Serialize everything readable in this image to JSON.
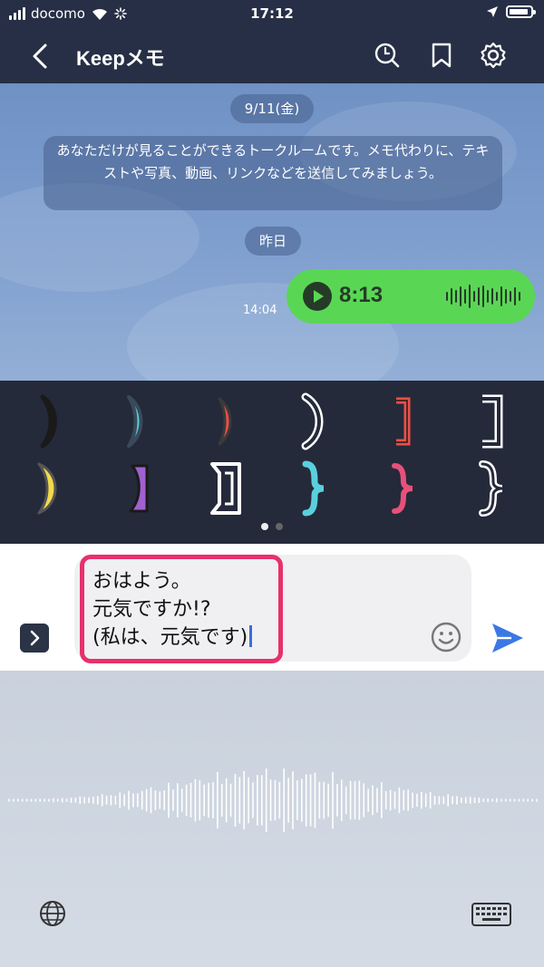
{
  "status_bar": {
    "carrier": "docomo",
    "time": "17:12"
  },
  "nav": {
    "title": "Keepメモ"
  },
  "chat": {
    "date_1": "9/11(金)",
    "system_message": "あなただけが見ることができるトークルームです。メモ代わりに、テキストや写真、動画、リンクなどを送信してみましょう。",
    "date_2": "昨日",
    "voice_message": {
      "time": "14:04",
      "duration": "8:13"
    }
  },
  "emoji_panel": {
    "items": [
      {
        "name": "cyan-open-paren-sticker",
        "color": "#5ad0de"
      },
      {
        "name": "cyan-close-paren-sticker",
        "color": "#5ad0de"
      },
      {
        "name": "red-close-paren-sticker",
        "color": "#e8504a"
      },
      {
        "name": "white-close-paren-sticker",
        "color": "#ffffff"
      },
      {
        "name": "red-bracket-sticker",
        "color": "#e8504a"
      },
      {
        "name": "white-bracket-sticker",
        "color": "#ffffff"
      },
      {
        "name": "yellow-close-paren-sticker",
        "color": "#f2d94a"
      },
      {
        "name": "purple-close-paren-sticker",
        "color": "#a160d0"
      },
      {
        "name": "white-lenticular-bracket-sticker",
        "color": "#ffffff"
      },
      {
        "name": "cyan-close-brace-sticker",
        "color": "#5ad0de"
      },
      {
        "name": "pink-close-brace-sticker",
        "color": "#e8507a"
      },
      {
        "name": "white-close-brace-sticker",
        "color": "#ffffff"
      }
    ],
    "page_count": 2,
    "current_page": 1
  },
  "input": {
    "line_1": "おはよう。",
    "line_2": "元気ですか!?",
    "line_3": "(私は、元気です)",
    "highlight_color": "#e8306d"
  },
  "colors": {
    "header_bg": "#272f46",
    "bubble_green": "#5ad655",
    "send_blue": "#3b78e6"
  }
}
